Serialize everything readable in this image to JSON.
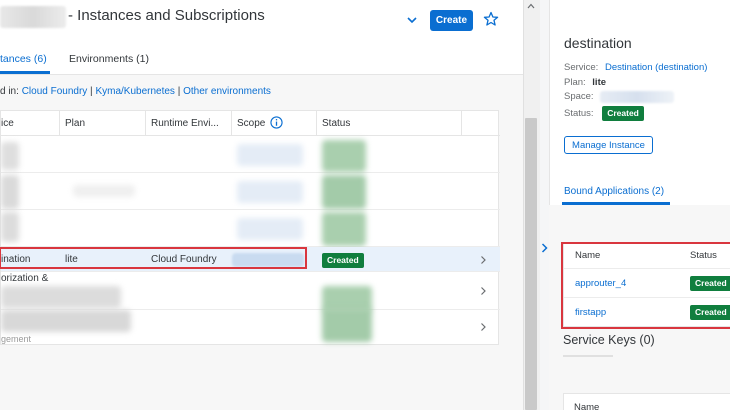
{
  "header": {
    "title": "- Instances and Subscriptions",
    "create_label": "Create"
  },
  "tabs": [
    {
      "label": "tances (6)"
    },
    {
      "label": "Environments (1)"
    }
  ],
  "links": {
    "prefix": "d in:",
    "cloud_foundry": "Cloud Foundry",
    "sep1": " | ",
    "kyma": "Kyma/Kubernetes",
    "sep2": " | ",
    "other": "Other environments"
  },
  "table": {
    "columns": [
      "ice",
      "Plan",
      "Runtime Envi...",
      "Scope",
      "Status"
    ],
    "selected_row": {
      "service": "ination",
      "plan": "lite",
      "runtime": "Cloud Foundry",
      "status": "Created"
    },
    "fragment_row_5": "orization &",
    "fragment_row_7": "gement"
  },
  "detail": {
    "title": "destination",
    "service_label": "Service:",
    "service_value": "Destination (destination)",
    "plan_label": "Plan:",
    "plan_value": "lite",
    "space_label": "Space:",
    "status_label": "Status:",
    "status_value": "Created",
    "manage_label": "Manage Instance",
    "bound_tab": "Bound Applications (2)",
    "bound_table": {
      "columns": [
        "Name",
        "Status"
      ],
      "rows": [
        {
          "name": "approuter_4",
          "status": "Created"
        },
        {
          "name": "firstapp",
          "status": "Created"
        }
      ]
    },
    "service_keys_title": "Service Keys (0)",
    "service_keys_columns": [
      "Name"
    ]
  },
  "colors": {
    "accent": "#0a6ed1",
    "success": "#107e3e",
    "highlight": "#d9363e"
  }
}
